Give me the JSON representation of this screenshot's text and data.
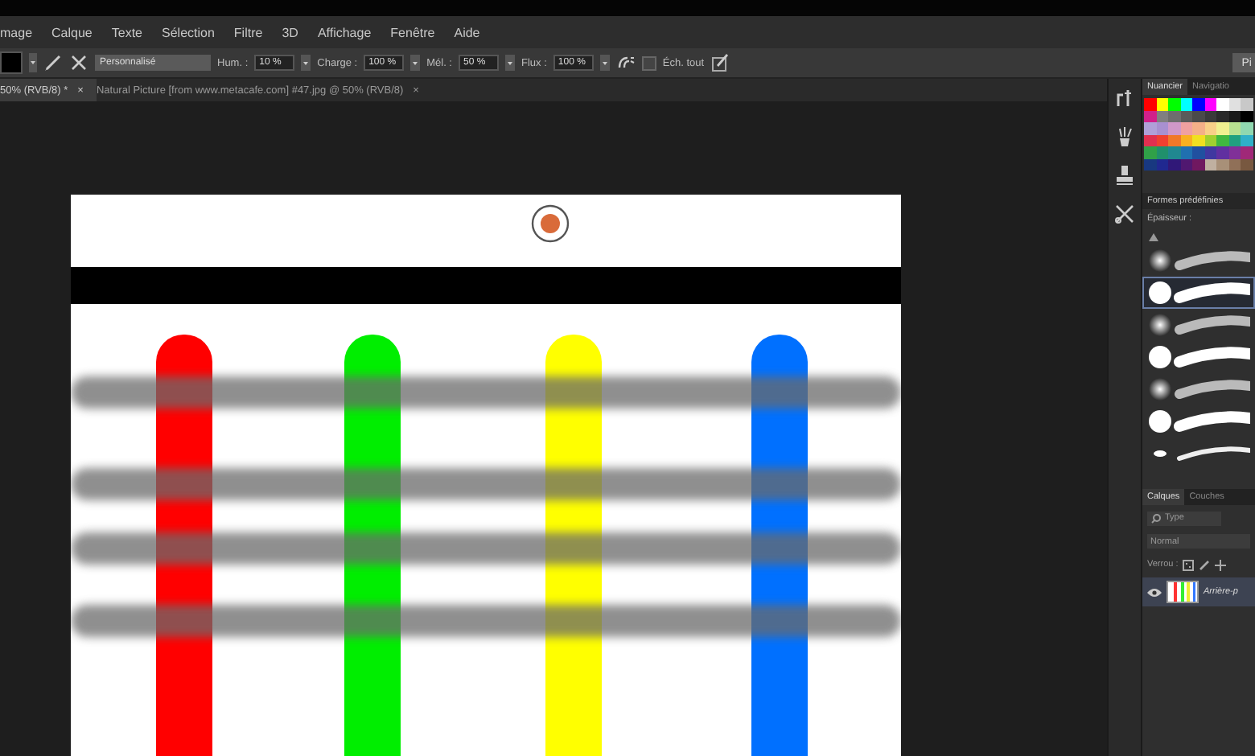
{
  "menu": [
    "mage",
    "Calque",
    "Texte",
    "Sélection",
    "Filtre",
    "3D",
    "Affichage",
    "Fenêtre",
    "Aide"
  ],
  "options": {
    "preset": "Personnalisé",
    "fields": [
      {
        "label": "Hum. :",
        "value": "10 %"
      },
      {
        "label": "Charge :",
        "value": "100 %"
      },
      {
        "label": "Mél. :",
        "value": "50 %"
      },
      {
        "label": "Flux :",
        "value": "100 %"
      }
    ],
    "sample_all": {
      "label": "Éch. tout",
      "checked": false
    },
    "right_button": "Pi"
  },
  "documents": [
    {
      "title": "50% (RVB/8) *",
      "close": "×",
      "selected": true
    },
    {
      "title": "Natural Picture [from www.metacafe.com] #47.jpg @ 50% (RVB/8)",
      "close": "×",
      "selected": false
    }
  ],
  "panel": {
    "swatch_tabs": [
      {
        "label": "Nuancier",
        "selected": true
      },
      {
        "label": "Navigatio",
        "selected": false
      }
    ],
    "swatches": [
      {
        "color": "#ff0000"
      },
      {
        "color": "#ffff00"
      },
      {
        "color": "#00ff00"
      },
      {
        "color": "#00ffff"
      },
      {
        "color": "#0000ff"
      },
      {
        "color": "#ff00ff"
      },
      {
        "color": "#ffffff"
      },
      {
        "color": "#e0e0e0"
      },
      {
        "color": "#c8c8c8"
      },
      {
        "color": "#d0208a"
      },
      {
        "color": "#808080"
      },
      {
        "color": "#6e6e6e"
      },
      {
        "color": "#5a5a5a"
      },
      {
        "color": "#4a4a4a"
      },
      {
        "color": "#3a3a3a"
      },
      {
        "color": "#2a2a2a"
      },
      {
        "color": "#1a1a1a"
      },
      {
        "color": "#000000"
      },
      {
        "color": "#b0a0d8"
      },
      {
        "color": "#a890d0"
      },
      {
        "color": "#d098c8"
      },
      {
        "color": "#f0a0a0"
      },
      {
        "color": "#f4b088"
      },
      {
        "color": "#f8d088"
      },
      {
        "color": "#f0f090"
      },
      {
        "color": "#b8e090"
      },
      {
        "color": "#90d8b0"
      },
      {
        "color": "#e03050"
      },
      {
        "color": "#f04030"
      },
      {
        "color": "#f07828"
      },
      {
        "color": "#f8b020"
      },
      {
        "color": "#f0e020"
      },
      {
        "color": "#a0d030"
      },
      {
        "color": "#40b840"
      },
      {
        "color": "#20a080"
      },
      {
        "color": "#30b0c8"
      },
      {
        "color": "#30a048"
      },
      {
        "color": "#20906c"
      },
      {
        "color": "#208890"
      },
      {
        "color": "#2070b0"
      },
      {
        "color": "#2050a0"
      },
      {
        "color": "#4038a0"
      },
      {
        "color": "#6030a0"
      },
      {
        "color": "#803098"
      },
      {
        "color": "#a02878"
      },
      {
        "color": "#183880"
      },
      {
        "color": "#202890"
      },
      {
        "color": "#301878"
      },
      {
        "color": "#501870"
      },
      {
        "color": "#701860"
      },
      {
        "color": "#c0b0a0"
      },
      {
        "color": "#a89078"
      },
      {
        "color": "#907058"
      },
      {
        "color": "#785840"
      }
    ],
    "presets_title": "Formes prédéfinies",
    "size_label": "Épaisseur :",
    "brushes": [
      {
        "kind": "soft",
        "selected": false
      },
      {
        "kind": "hard",
        "selected": true
      },
      {
        "kind": "soft",
        "selected": false
      },
      {
        "kind": "hard",
        "selected": false
      },
      {
        "kind": "soft",
        "selected": false
      },
      {
        "kind": "hard",
        "selected": false
      },
      {
        "kind": "small",
        "selected": false
      }
    ],
    "layer_tabs": [
      {
        "label": "Calques",
        "selected": true
      },
      {
        "label": "Couches",
        "selected": false
      }
    ],
    "filter": "Type",
    "blend_mode": "Normal",
    "lock_label": "Verrou :",
    "layers": [
      {
        "name": "Arrière-p",
        "visible": true
      }
    ]
  }
}
